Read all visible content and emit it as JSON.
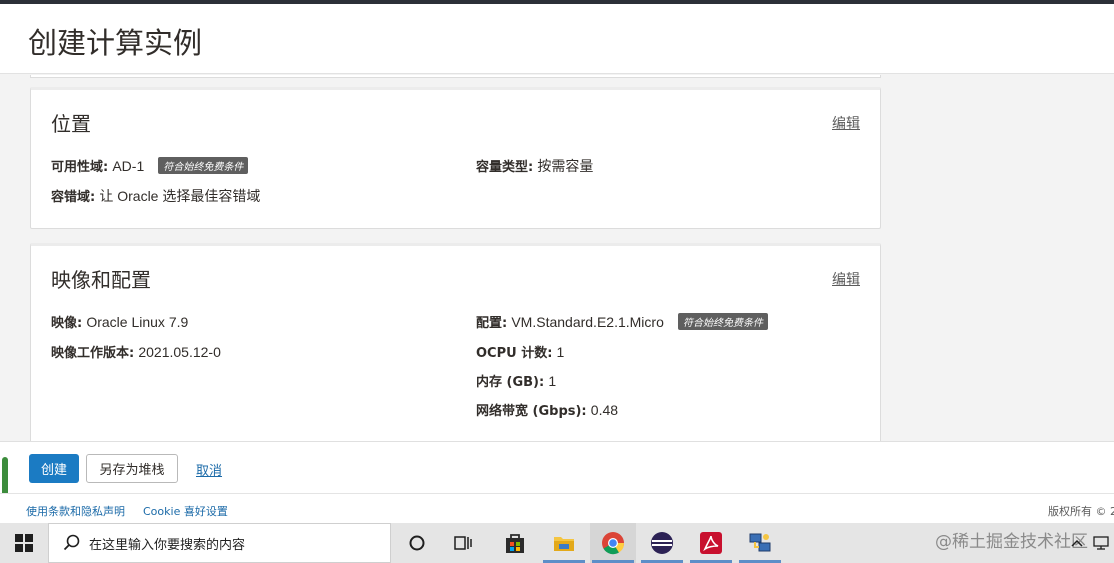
{
  "page": {
    "title": "创建计算实例"
  },
  "location": {
    "title": "位置",
    "edit_label": "编辑",
    "availability_domain": {
      "label": "可用性域:",
      "value": "AD-1",
      "badge": "符合始终免费条件"
    },
    "capacity_type": {
      "label": "容量类型:",
      "value": "按需容量"
    },
    "fault_domain": {
      "label": "容错域:",
      "value": "让 Oracle 选择最佳容错域"
    }
  },
  "image_config": {
    "title": "映像和配置",
    "edit_label": "编辑",
    "image": {
      "label": "映像:",
      "value": "Oracle Linux 7.9"
    },
    "image_build": {
      "label": "映像工作版本:",
      "value": "2021.05.12-0"
    },
    "shape": {
      "label": "配置:",
      "value": "VM.Standard.E2.1.Micro",
      "badge": "符合始终免费条件"
    },
    "ocpu": {
      "label": "OCPU 计数:",
      "value": "1"
    },
    "memory": {
      "label": "内存 (GB):",
      "value": "1"
    },
    "bandwidth": {
      "label": "网络带宽 (Gbps):",
      "value": "0.48"
    }
  },
  "actions": {
    "create_label": "创建",
    "save_stack_label": "另存为堆栈",
    "cancel_label": "取消"
  },
  "footer": {
    "terms_label": "使用条款和隐私声明",
    "cookie_label": "Cookie 喜好设置",
    "copyright": "版权所有 © 2"
  },
  "taskbar": {
    "search_placeholder": "在这里输入你要搜索的内容",
    "watermark": "@稀土掘金技术社区",
    "apps": [
      "task-view",
      "timeline",
      "store",
      "file-explorer",
      "chrome",
      "eclipse",
      "acrobat",
      "network-app"
    ]
  },
  "colors": {
    "primary_button": "#1b7bc3",
    "link": "#1b6aa8",
    "badge_bg": "#5f5f5f",
    "scroll_handle": "#3c8c3c"
  }
}
